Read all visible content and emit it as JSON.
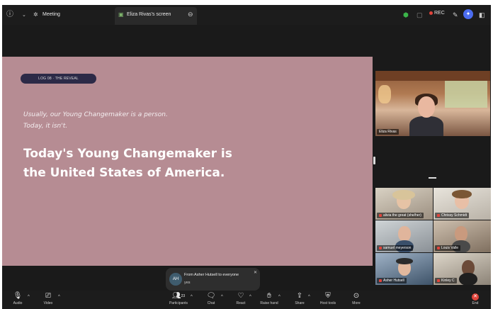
{
  "topbar": {
    "meeting_label": "Meeting",
    "screen_tab_label": "Eliza Rivas's screen",
    "rec_label": "REC"
  },
  "slide": {
    "tag": "LOG 08 · THE REVEAL",
    "lead_1": "Usually, our Young Changemaker is a person.",
    "lead_2": "Today, it isn't.",
    "headline_1": "Today's Young Changemaker is",
    "headline_2": "the United States of America."
  },
  "speaker": {
    "name": "Eliza Rivas"
  },
  "participants": [
    {
      "name": "alivia the great (she/her)"
    },
    {
      "name": "Chrissy Schmidt"
    },
    {
      "name": "samuel meyerson"
    },
    {
      "name": "Louis Valle"
    },
    {
      "name": "Asher Hutsell"
    },
    {
      "name": "Kinley C"
    }
  ],
  "toast": {
    "initials": "AH",
    "from": "From Asher Hutsell to everyone",
    "message": "yes"
  },
  "toolbar": {
    "audio": "Audio",
    "video": "Video",
    "participants": "Participants",
    "participants_count": "23",
    "chat": "Chat",
    "react": "React",
    "raise_hand": "Raise hand",
    "share": "Share",
    "host_tools": "Host tools",
    "more": "More",
    "end": "End"
  },
  "colors": {
    "slide_bg": "#b68c93",
    "tag_bg": "#2c2a47",
    "rec_dot": "#e0443b",
    "shield": "#3bb54a",
    "ai_companion": "#4b6cf0"
  }
}
